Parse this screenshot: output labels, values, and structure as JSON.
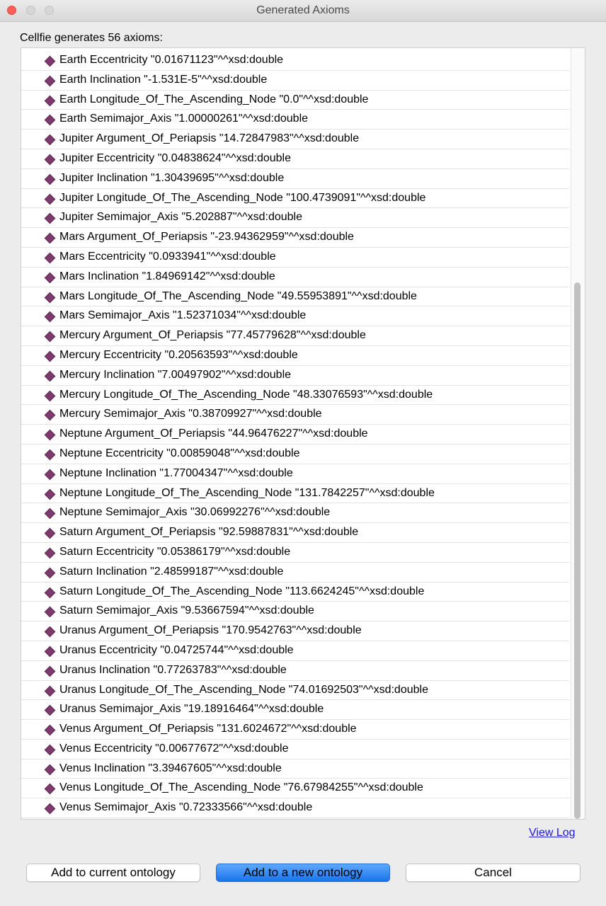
{
  "window": {
    "title": "Generated Axioms"
  },
  "summary": "Cellfie generates 56 axioms:",
  "axioms": [
    "Earth Eccentricity \"0.01671123\"^^xsd:double",
    "Earth Inclination \"-1.531E-5\"^^xsd:double",
    "Earth Longitude_Of_The_Ascending_Node \"0.0\"^^xsd:double",
    "Earth Semimajor_Axis \"1.00000261\"^^xsd:double",
    "Jupiter Argument_Of_Periapsis \"14.72847983\"^^xsd:double",
    "Jupiter Eccentricity \"0.04838624\"^^xsd:double",
    "Jupiter Inclination \"1.30439695\"^^xsd:double",
    "Jupiter Longitude_Of_The_Ascending_Node \"100.4739091\"^^xsd:double",
    "Jupiter Semimajor_Axis \"5.202887\"^^xsd:double",
    "Mars Argument_Of_Periapsis \"-23.94362959\"^^xsd:double",
    "Mars Eccentricity \"0.0933941\"^^xsd:double",
    "Mars Inclination \"1.84969142\"^^xsd:double",
    "Mars Longitude_Of_The_Ascending_Node \"49.55953891\"^^xsd:double",
    "Mars Semimajor_Axis \"1.52371034\"^^xsd:double",
    "Mercury Argument_Of_Periapsis \"77.45779628\"^^xsd:double",
    "Mercury Eccentricity \"0.20563593\"^^xsd:double",
    "Mercury Inclination \"7.00497902\"^^xsd:double",
    "Mercury Longitude_Of_The_Ascending_Node \"48.33076593\"^^xsd:double",
    "Mercury Semimajor_Axis \"0.38709927\"^^xsd:double",
    "Neptune Argument_Of_Periapsis \"44.96476227\"^^xsd:double",
    "Neptune Eccentricity \"0.00859048\"^^xsd:double",
    "Neptune Inclination \"1.77004347\"^^xsd:double",
    "Neptune Longitude_Of_The_Ascending_Node \"131.7842257\"^^xsd:double",
    "Neptune Semimajor_Axis \"30.06992276\"^^xsd:double",
    "Saturn Argument_Of_Periapsis \"92.59887831\"^^xsd:double",
    "Saturn Eccentricity \"0.05386179\"^^xsd:double",
    "Saturn Inclination \"2.48599187\"^^xsd:double",
    "Saturn Longitude_Of_The_Ascending_Node \"113.6624245\"^^xsd:double",
    "Saturn Semimajor_Axis \"9.53667594\"^^xsd:double",
    "Uranus Argument_Of_Periapsis \"170.9542763\"^^xsd:double",
    "Uranus Eccentricity \"0.04725744\"^^xsd:double",
    "Uranus Inclination \"0.77263783\"^^xsd:double",
    "Uranus Longitude_Of_The_Ascending_Node \"74.01692503\"^^xsd:double",
    "Uranus Semimajor_Axis \"19.18916464\"^^xsd:double",
    "Venus Argument_Of_Periapsis \"131.6024672\"^^xsd:double",
    "Venus Eccentricity \"0.00677672\"^^xsd:double",
    "Venus Inclination \"3.39467605\"^^xsd:double",
    "Venus Longitude_Of_The_Ascending_Node \"76.67984255\"^^xsd:double",
    "Venus Semimajor_Axis \"0.72333566\"^^xsd:double"
  ],
  "axiom_icon": "data-property-assertion-diamond-icon",
  "colors": {
    "icon": "#7d3a6c",
    "link": "#1a1ad6",
    "primary_button": "#1a73ee",
    "close": "#fc5f57"
  },
  "links": {
    "view_log": "View Log"
  },
  "buttons": {
    "add_current": "Add to current ontology",
    "add_new": "Add to a new ontology",
    "cancel": "Cancel"
  }
}
